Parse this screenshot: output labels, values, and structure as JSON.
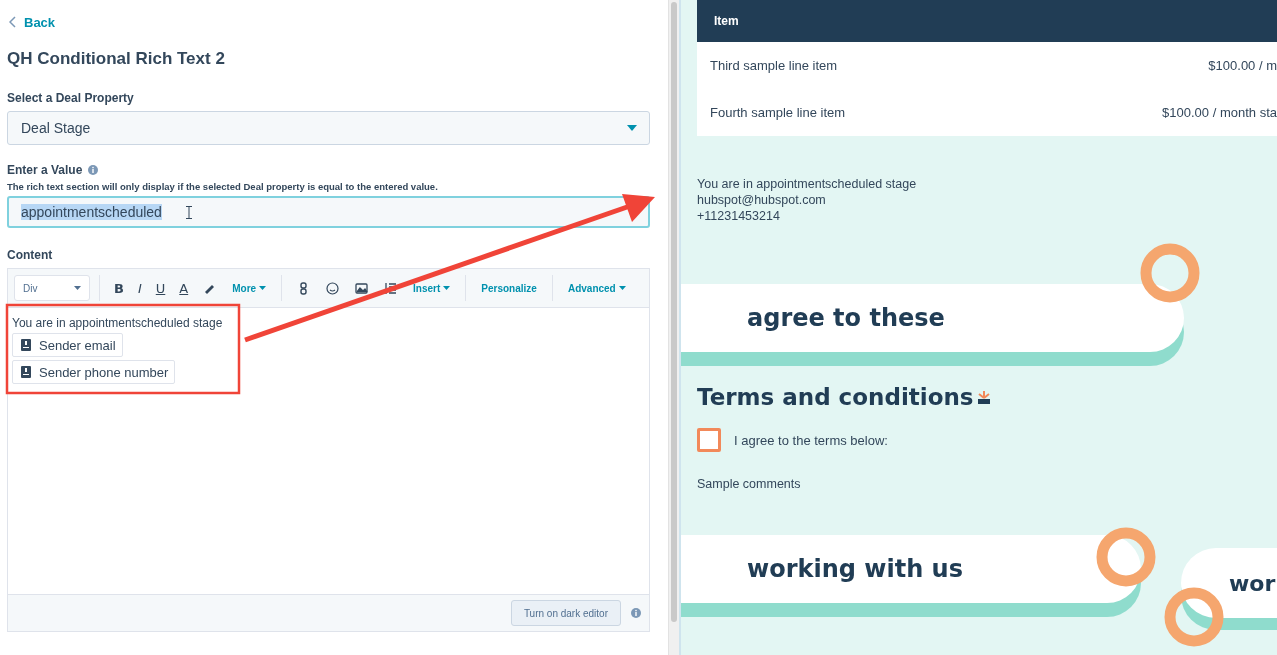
{
  "back": {
    "label": "Back"
  },
  "title": "QH Conditional Rich Text 2",
  "property_field": {
    "label": "Select a Deal Property",
    "value": "Deal Stage"
  },
  "value_field": {
    "label": "Enter a Value",
    "help": "The rich text section will only display if the selected Deal property is equal to the entered value.",
    "value": "appointmentscheduled",
    "selected": true
  },
  "content": {
    "label": "Content",
    "toolbar": [
      {
        "kind": "select",
        "label": "Div"
      },
      {
        "kind": "divider"
      },
      {
        "kind": "bold",
        "label": "B"
      },
      {
        "kind": "italic",
        "label": "I"
      },
      {
        "kind": "underline",
        "label": "U"
      },
      {
        "kind": "color",
        "label": "A"
      },
      {
        "kind": "pen"
      },
      {
        "kind": "menu",
        "label": "More"
      },
      {
        "kind": "divider"
      },
      {
        "kind": "link"
      },
      {
        "kind": "smile"
      },
      {
        "kind": "image"
      },
      {
        "kind": "list"
      },
      {
        "kind": "menu",
        "label": "Insert"
      },
      {
        "kind": "divider"
      },
      {
        "kind": "personalize",
        "label": "Personalize"
      },
      {
        "kind": "divider"
      },
      {
        "kind": "menu",
        "label": "Advanced"
      }
    ],
    "text": "You are in appointmentscheduled stage",
    "tokens": [
      {
        "label": "Sender email"
      },
      {
        "label": "Sender phone number"
      }
    ],
    "footer_button": "Turn on dark editor"
  },
  "preview": {
    "table": {
      "columns": [
        "Item"
      ],
      "rows": [
        {
          "item": "Third sample line item",
          "price": "$100.00 / m"
        },
        {
          "item": "Fourth sample line item",
          "price": "$100.00 / month sta"
        }
      ]
    },
    "message": [
      "You are in appointmentscheduled stage",
      "hubspot@hubspot.com",
      "+11231453214"
    ],
    "banner_top": "agree to these",
    "terms": {
      "heading": "Terms and conditions",
      "checkbox": {
        "label": "I agree to the terms below:",
        "checked": false
      },
      "comments": "Sample comments"
    },
    "banner_bottom": "working with us",
    "banner_side": "wor"
  }
}
